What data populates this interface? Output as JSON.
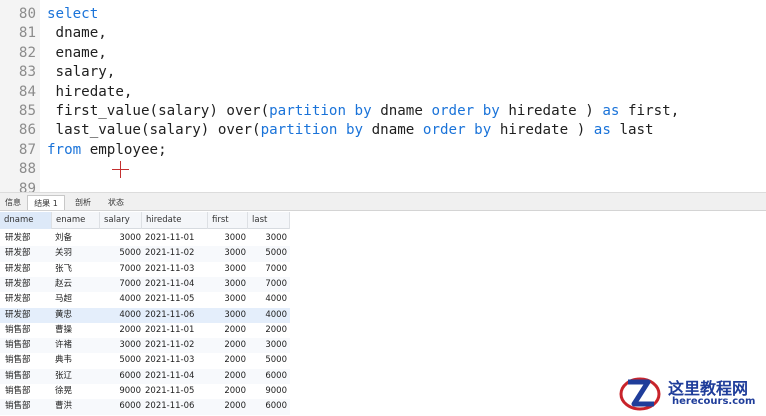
{
  "editor": {
    "lines": [
      {
        "num": "80",
        "code": "select"
      },
      {
        "num": "81",
        "code": " dname,"
      },
      {
        "num": "82",
        "code": " ename,"
      },
      {
        "num": "83",
        "code": " salary,"
      },
      {
        "num": "84",
        "code": " hiredate,"
      },
      {
        "num": "85",
        "code": " first_value(salary) over(partition by dname order by hiredate ) as first,"
      },
      {
        "num": "86",
        "code": " last_value(salary) over(partition by dname order by hiredate ) as last"
      },
      {
        "num": "87",
        "code": "from employee;"
      },
      {
        "num": "88",
        "code": ""
      },
      {
        "num": "89",
        "code": ""
      }
    ],
    "keywords": [
      "select",
      "partition",
      "by",
      "order",
      "as",
      "from"
    ],
    "keyword_color": "#1a73d9"
  },
  "tabs": [
    "信息",
    "结果 1",
    "剖析",
    "状态"
  ],
  "active_tab": "结果 1",
  "grid": {
    "columns": [
      "dname",
      "ename",
      "salary",
      "hiredate",
      "first",
      "last"
    ],
    "rows": [
      [
        "研发部",
        "刘备",
        "3000",
        "2021-11-01",
        "3000",
        "3000"
      ],
      [
        "研发部",
        "关羽",
        "5000",
        "2021-11-02",
        "3000",
        "5000"
      ],
      [
        "研发部",
        "张飞",
        "7000",
        "2021-11-03",
        "3000",
        "7000"
      ],
      [
        "研发部",
        "赵云",
        "7000",
        "2021-11-04",
        "3000",
        "7000"
      ],
      [
        "研发部",
        "马超",
        "4000",
        "2021-11-05",
        "3000",
        "4000"
      ],
      [
        "研发部",
        "黄忠",
        "4000",
        "2021-11-06",
        "3000",
        "4000"
      ],
      [
        "销售部",
        "曹操",
        "2000",
        "2021-11-01",
        "2000",
        "2000"
      ],
      [
        "销售部",
        "许褚",
        "3000",
        "2021-11-02",
        "2000",
        "3000"
      ],
      [
        "销售部",
        "典韦",
        "5000",
        "2021-11-03",
        "2000",
        "5000"
      ],
      [
        "销售部",
        "张辽",
        "6000",
        "2021-11-04",
        "2000",
        "6000"
      ],
      [
        "销售部",
        "徐晃",
        "9000",
        "2021-11-05",
        "2000",
        "9000"
      ],
      [
        "销售部",
        "曹洪",
        "6000",
        "2021-11-06",
        "2000",
        "6000"
      ]
    ]
  },
  "watermark": {
    "title": "这里教程网",
    "domain": "herecours.com",
    "icon": "z-logo-icon"
  }
}
